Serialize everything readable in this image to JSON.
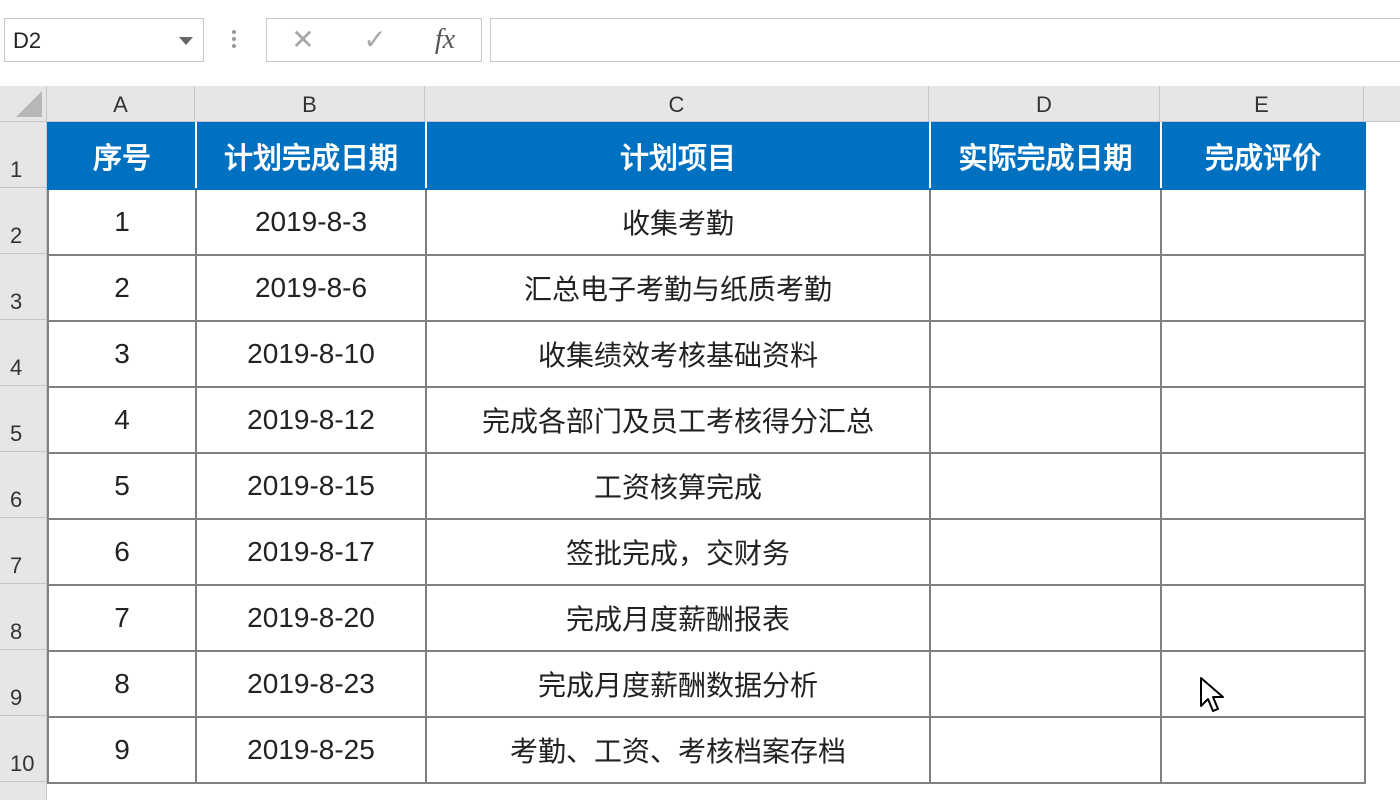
{
  "name_box": {
    "value": "D2"
  },
  "formula_bar": {
    "cancel_icon": "✕",
    "enter_icon": "✓",
    "fx_label": "fx",
    "formula_value": ""
  },
  "column_headers": [
    "A",
    "B",
    "C",
    "D",
    "E"
  ],
  "row_headers": [
    "1",
    "2",
    "3",
    "4",
    "5",
    "6",
    "7",
    "8",
    "9",
    "10"
  ],
  "colors": {
    "header_fill": "#0070c0",
    "header_text": "#ffffff",
    "grid_border": "#808080"
  },
  "table": {
    "headers": [
      "序号",
      "计划完成日期",
      "计划项目",
      "实际完成日期",
      "完成评价"
    ],
    "rows": [
      [
        "1",
        "2019-8-3",
        "收集考勤",
        "",
        ""
      ],
      [
        "2",
        "2019-8-6",
        "汇总电子考勤与纸质考勤",
        "",
        ""
      ],
      [
        "3",
        "2019-8-10",
        "收集绩效考核基础资料",
        "",
        ""
      ],
      [
        "4",
        "2019-8-12",
        "完成各部门及员工考核得分汇总",
        "",
        ""
      ],
      [
        "5",
        "2019-8-15",
        "工资核算完成",
        "",
        ""
      ],
      [
        "6",
        "2019-8-17",
        "签批完成，交财务",
        "",
        ""
      ],
      [
        "7",
        "2019-8-20",
        "完成月度薪酬报表",
        "",
        ""
      ],
      [
        "8",
        "2019-8-23",
        "完成月度薪酬数据分析",
        "",
        ""
      ],
      [
        "9",
        "2019-8-25",
        "考勤、工资、考核档案存档",
        "",
        ""
      ]
    ]
  }
}
